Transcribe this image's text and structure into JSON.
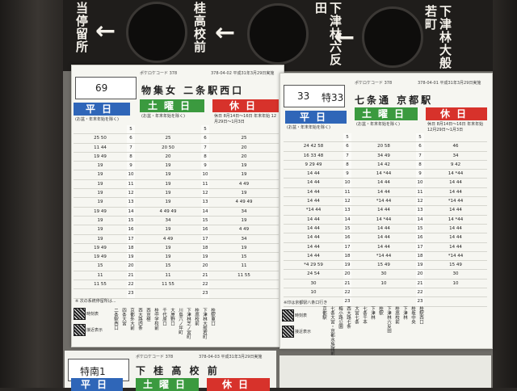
{
  "top_stops": [
    {
      "label": "当停留所",
      "arrow": "←"
    },
    {
      "label": "桂高校前",
      "arrow": "←"
    },
    {
      "label": "下津林六反田",
      "arrow": "←"
    },
    {
      "label": "下津林大般若町",
      "arrow": ""
    }
  ],
  "timetables": [
    {
      "route": "69",
      "code": "ポケロケコード 378",
      "meta": "378-04-02 平成31年3月29日実施",
      "destination": "物集女 二条駅西口",
      "header_weekday": "平日",
      "header_saturday": "土曜日",
      "header_holiday": "休日",
      "sub_weekday": "(お盆・年末年始を除く)",
      "sub_saturday": "(お盆・年末年始を除く)",
      "sub_holiday": "休日 8月14日～16日 年末年始 12月29日～1月3日",
      "hours": [
        "5",
        "6",
        "7",
        "8",
        "9",
        "10",
        "11",
        "12",
        "13",
        "14",
        "15",
        "16",
        "17",
        "18",
        "19",
        "20",
        "21",
        "22",
        "23"
      ],
      "weekday": [
        "",
        "25 50",
        "11 44",
        "19 49",
        "19",
        "19",
        "19",
        "19",
        "19",
        "19 49",
        "19",
        "19",
        "19",
        "19 49",
        "19 49",
        "15",
        "11",
        "11 55",
        ""
      ],
      "saturday": [
        "",
        "25",
        "20 50",
        "20",
        "19",
        "19",
        "19",
        "19",
        "19",
        "4 49 49",
        "34",
        "19",
        "4 49",
        "19",
        "19",
        "15",
        "11",
        "11 55",
        ""
      ],
      "holiday": [
        "",
        "25",
        "20",
        "20",
        "19",
        "19",
        "4 49",
        "19",
        "4 49 49",
        "34",
        "19",
        "4 49",
        "34",
        "19",
        "15",
        "11",
        "11 55",
        "",
        ""
      ],
      "note": "※ 次の系統停留所は..."
    },
    {
      "route": "33",
      "route2": "特33",
      "code": "ポケロケコード 378",
      "meta": "378-04-01 平成31年3月29日実施",
      "destination": "七条通 京都駅",
      "header_weekday": "平日",
      "header_saturday": "土曜日",
      "header_holiday": "休日",
      "sub_weekday": "(お盆・年末年始を除く)",
      "sub_saturday": "(お盆・年末年始を除く)",
      "sub_holiday": "休日 8月14日～16日 年末年始 12月29日～1月3日",
      "hours": [
        "5",
        "6",
        "7",
        "8",
        "9",
        "10",
        "11",
        "12",
        "13",
        "14",
        "15",
        "16",
        "17",
        "18",
        "19",
        "20",
        "21",
        "22",
        "23"
      ],
      "weekday": [
        "",
        "24 42 58",
        "16 33 48",
        "9 29 49",
        "14 44",
        "14 44",
        "14 44",
        "14 44",
        "*14 44",
        "14 44",
        "14 44",
        "14 44",
        "14 44",
        "14 44",
        "*4 29 59",
        "24 54",
        "30",
        "10",
        ""
      ],
      "saturday": [
        "",
        "20 58",
        "34 49",
        "14 42",
        "14 *44",
        "14 44",
        "14 44",
        "*14 44",
        "14 44",
        "14 *44",
        "14 44",
        "14 44",
        "14 44",
        "*14 44",
        "15 49",
        "30",
        "10",
        "",
        ""
      ],
      "holiday": [
        "",
        "46",
        "34",
        "9 42",
        "14 *44",
        "14 44",
        "14 44",
        "*14 44",
        "14 44",
        "14 *44",
        "14 44",
        "14 44",
        "14 44",
        "*14 44",
        "15 49",
        "30",
        "10",
        "",
        ""
      ],
      "note": "※印は京都駅八条口行き"
    }
  ],
  "bottom_left_stops": [
    "二条駅西口",
    "四条大宮",
    "京都外大前",
    "西大路四条",
    "西京極",
    "桂中学校前",
    "千代原口",
    "大原野口",
    "川島六ノ坪町",
    "下津林芝ノ宮町",
    "桂高校前",
    "下津林大般若町",
    "桂駅東口"
  ],
  "bottom_right_stops": [
    "京都駅",
    "七条大宮・京都水族館前",
    "梅小路公園",
    "西大路七条",
    "大宮七条",
    "七条千本",
    "下津林",
    "桂駅",
    "下津林六反田",
    "桂高校前",
    "下津林",
    "桂坂中央",
    "桂駅西口"
  ],
  "qr_labels": [
    "時刻表",
    "接近表示"
  ],
  "bottom_sheet": {
    "route": "特南1",
    "code": "ポケロケコード 378",
    "meta": "378-04-03 平成31年3月29日実施",
    "destination": "下 桂 高 校 前",
    "header_weekday": "平日",
    "header_saturday": "土曜日",
    "header_holiday": "休日"
  },
  "colors": {
    "weekday": "#2f66b8",
    "saturday": "#3b9a3f",
    "holiday": "#d7322b"
  }
}
